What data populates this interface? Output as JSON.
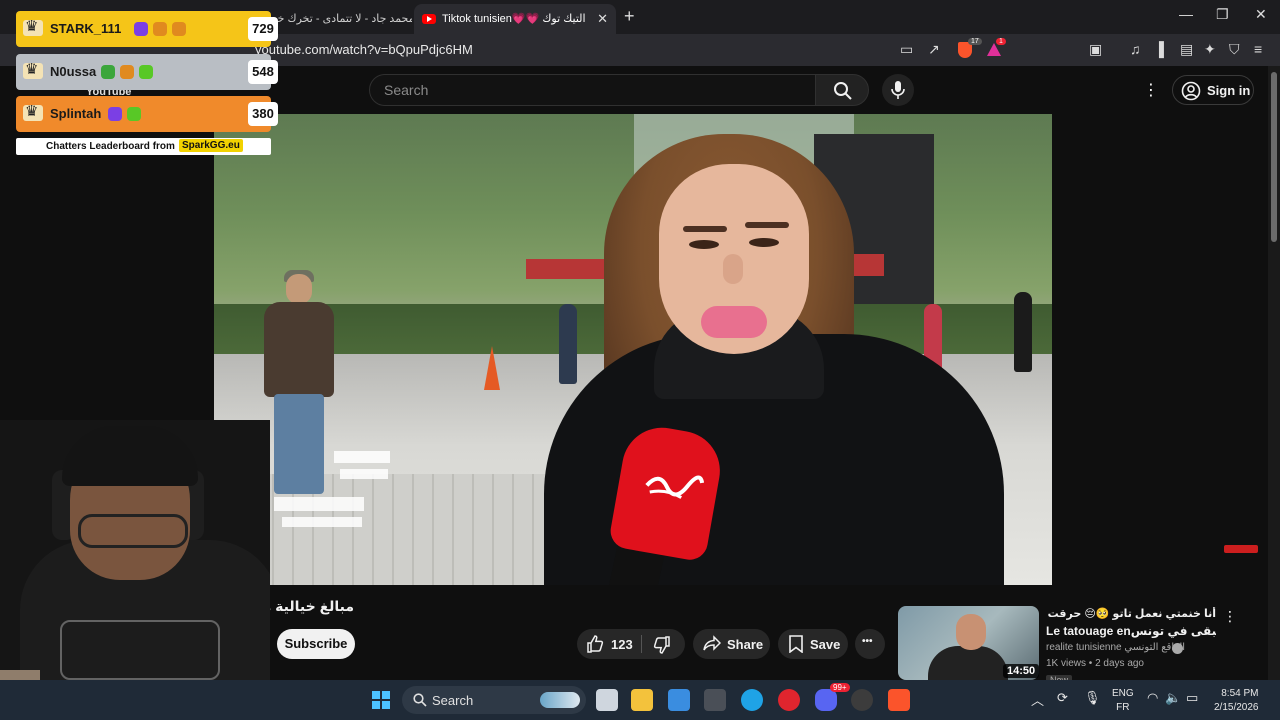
{
  "browser": {
    "tabs": [
      {
        "label": "محمد جاد - لا تتمادى - تخرك خو"
      },
      {
        "label": "Tiktok tunisien💗💗 التيك توك"
      }
    ],
    "new_tab": "+",
    "window_controls": {
      "minimize": "—",
      "maximize": "❐",
      "close": "✕"
    },
    "url": "youtube.com/watch?v=bQpuPdjc6HM",
    "shields_count": "17",
    "rewards_count": "1"
  },
  "youtube": {
    "logo_text": "YouTube",
    "search_placeholder": "Search",
    "sign_in": "Sign in",
    "video": {
      "title": "مبالغ خيالية من",
      "subscribe": "Subscribe",
      "likes": "123",
      "share": "Share",
      "save": "Save",
      "more": "•••"
    },
    "suggestion": {
      "title_line1": "أنا خنمتي نعمل تاتو 🥺😔 حرقت 5 مرات",
      "title_line2": "Le tatouage en‎منحبش نبقى في تونس...",
      "channel": "realite tunisienne الواقع التونسي",
      "meta": "1K views • 2 days ago",
      "badge": "New",
      "duration": "14:50"
    }
  },
  "leaderboard": {
    "rows": [
      {
        "name": "STARK_111",
        "score": "729",
        "color": "#f5c518"
      },
      {
        "name": "N0ussa",
        "score": "548",
        "color": "#b9bec4"
      },
      {
        "name": "Splintah",
        "score": "380",
        "color": "#f08a2b"
      }
    ],
    "footer_text": "Chatters Leaderboard from",
    "footer_brand": "SparkGG.eu"
  },
  "taskbar": {
    "search_label": "Search",
    "notification_count": "99+",
    "lang_primary": "ENG",
    "lang_secondary": "FR",
    "time": "8:54 PM",
    "date": "2/15/2026"
  }
}
